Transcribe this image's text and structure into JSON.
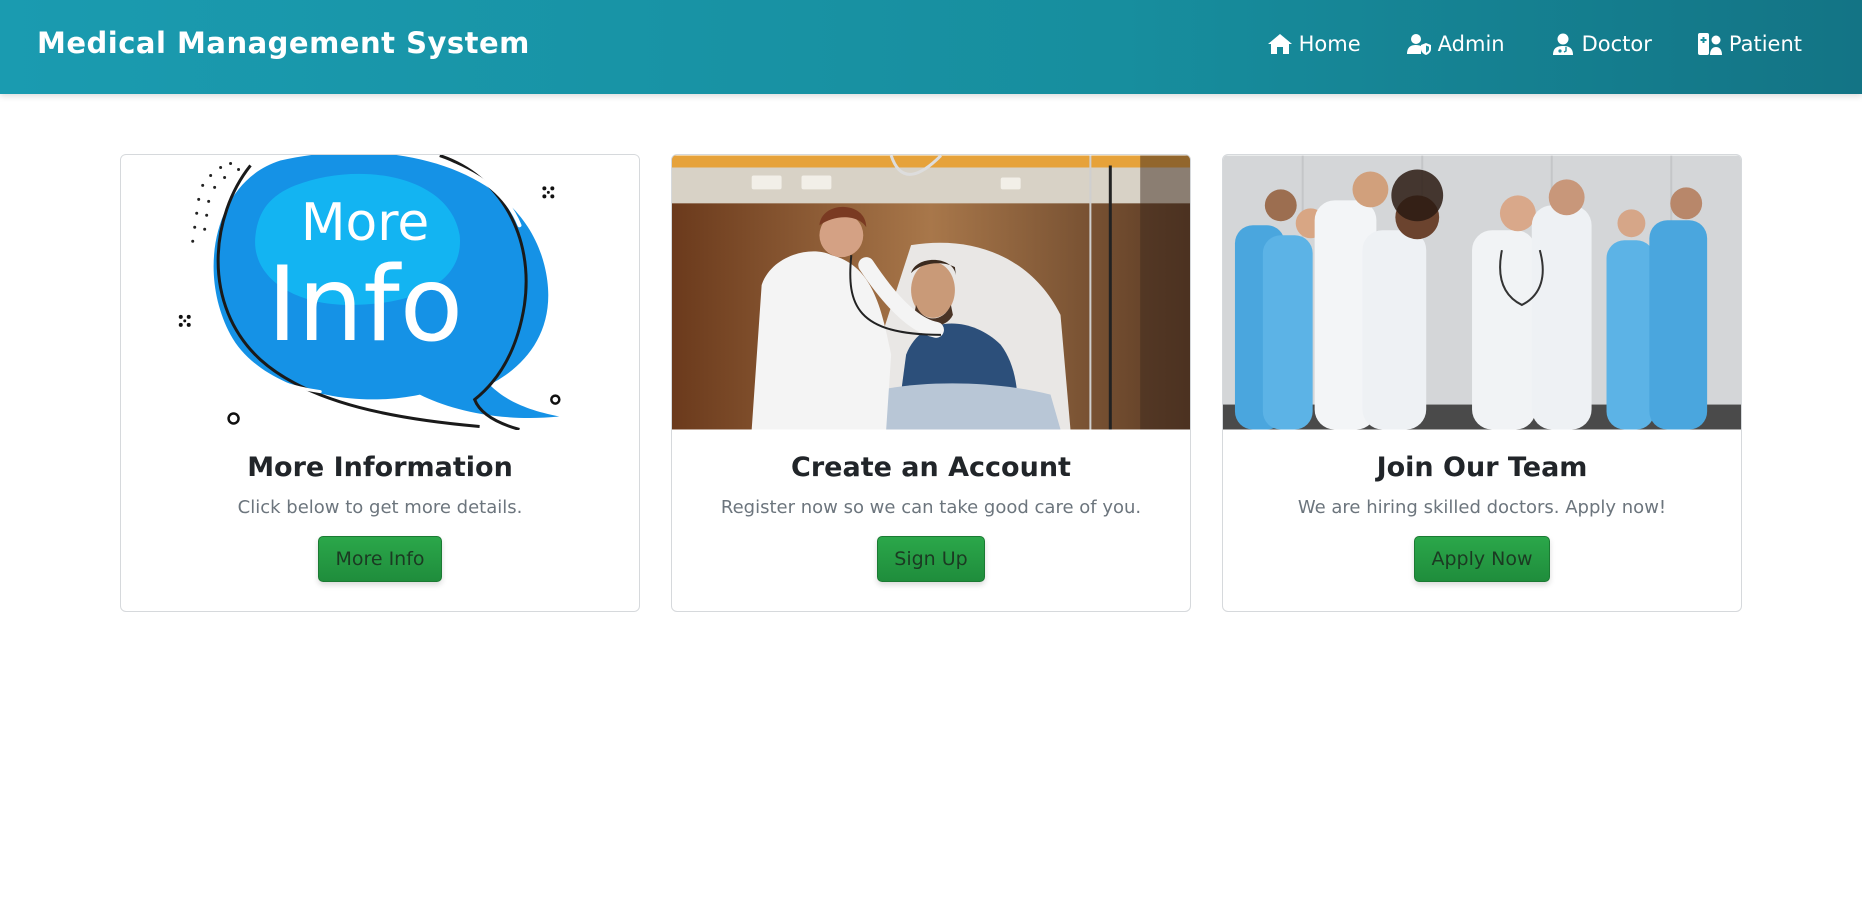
{
  "navbar": {
    "brand": "Medical Management System",
    "items": [
      {
        "label": "Home",
        "icon": "home-icon"
      },
      {
        "label": "Admin",
        "icon": "user-shield-icon"
      },
      {
        "label": "Doctor",
        "icon": "user-doctor-icon"
      },
      {
        "label": "Patient",
        "icon": "hospital-user-icon"
      }
    ]
  },
  "cards": [
    {
      "image": "more-info-speech-bubble-illustration",
      "image_text_1": "More",
      "image_text_2": "Info",
      "title": "More Information",
      "text": "Click below to get more details.",
      "button": "More Info"
    },
    {
      "image": "doctor-examining-patient-photo",
      "title": "Create an Account",
      "text": "Register now so we can take good care of you.",
      "button": "Sign Up"
    },
    {
      "image": "medical-team-group-photo",
      "title": "Join Our Team",
      "text": "We are hiring skilled doctors. Apply now!",
      "button": "Apply Now"
    }
  ],
  "colors": {
    "navbar": "#1a9bb0",
    "button": "#28a745",
    "title": "#212529",
    "muted": "#6c757d"
  }
}
